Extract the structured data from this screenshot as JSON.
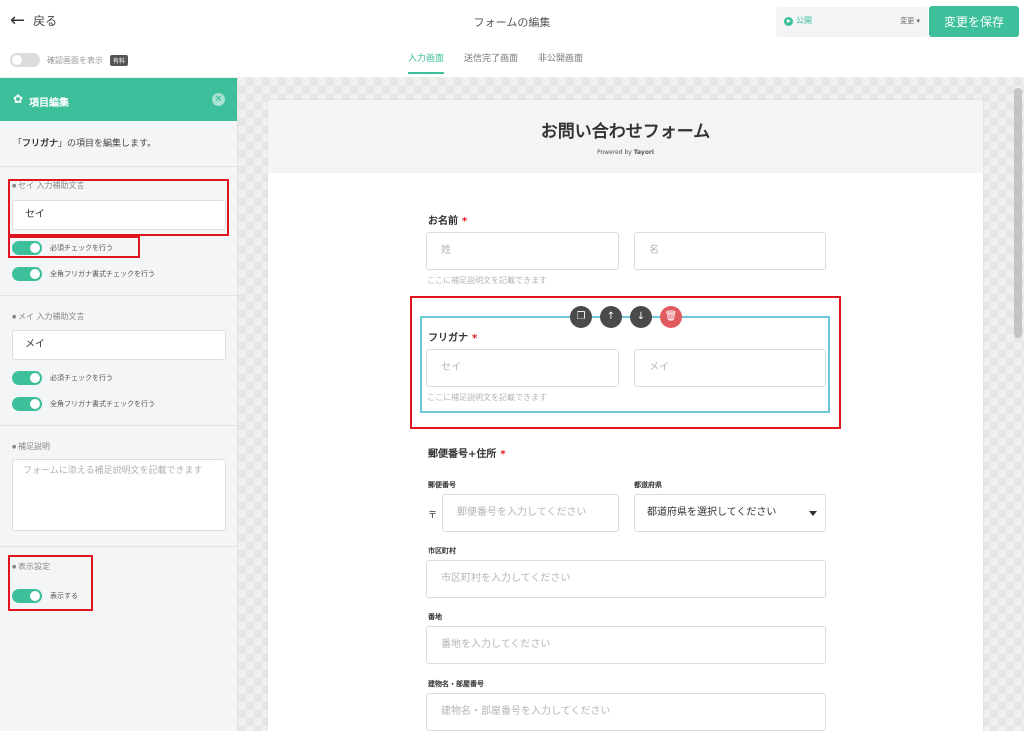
{
  "header": {
    "back_label": "戻る",
    "page_title": "フォームの編集",
    "status_label": "公開",
    "status_change": "変更",
    "save_label": "変更を保存"
  },
  "subbar": {
    "confirm_label": "確認画面を表示",
    "confirm_badge": "有料",
    "tabs": [
      {
        "label": "入力画面",
        "active": true
      },
      {
        "label": "送信完了画面",
        "active": false
      },
      {
        "label": "非公開画面",
        "active": false
      }
    ]
  },
  "sidebar": {
    "title": "項目編集",
    "desc_prefix": "「",
    "desc_field": "フリガナ",
    "desc_suffix": "」の項目を編集します。",
    "sei_label": "セイ 入力補助文言",
    "sei_value": "セイ",
    "sei_required": "必須チェックを行う",
    "sei_kana": "全角フリガナ書式チェックを行う",
    "mei_label": "メイ 入力補助文言",
    "mei_value": "メイ",
    "mei_required": "必須チェックを行う",
    "mei_kana": "全角フリガナ書式チェックを行う",
    "supplement_label": "補足説明",
    "supplement_placeholder": "フォームに添える補足説明文を記載できます",
    "display_label": "表示設定",
    "display_toggle": "表示する"
  },
  "form": {
    "title": "お問い合わせフォーム",
    "powered_by": "Powered by",
    "powered_brand": "Tayori",
    "name_label": "お名前",
    "name_last_placeholder": "姓",
    "name_first_placeholder": "名",
    "help_text": "ここに補足説明文を記載できます",
    "kana_label": "フリガナ",
    "kana_sei_placeholder": "セイ",
    "kana_mei_placeholder": "メイ",
    "kana_help": "ここに補足説明文を記載できます",
    "address_label": "郵便番号+住所",
    "postal_label": "郵便番号",
    "postal_mark": "〒",
    "postal_placeholder": "郵便番号を入力してください",
    "pref_label": "都道府県",
    "pref_value": "都道府県を選択してください",
    "city_label": "市区町村",
    "city_placeholder": "市区町村を入力してください",
    "street_label": "番地",
    "street_placeholder": "番地を入力してください",
    "building_label": "建物名・部屋番号",
    "building_placeholder": "建物名・部屋番号を入力してください",
    "required_mark": "*"
  },
  "colors": {
    "accent": "#3dbf9b",
    "highlight": "#e0141e",
    "selection": "#6ec7d8"
  },
  "icons": [
    "back-arrow-icon",
    "gear-icon",
    "close-icon",
    "copy-icon",
    "arrow-up-icon",
    "arrow-down-icon",
    "trash-icon",
    "dropdown-caret-icon"
  ]
}
